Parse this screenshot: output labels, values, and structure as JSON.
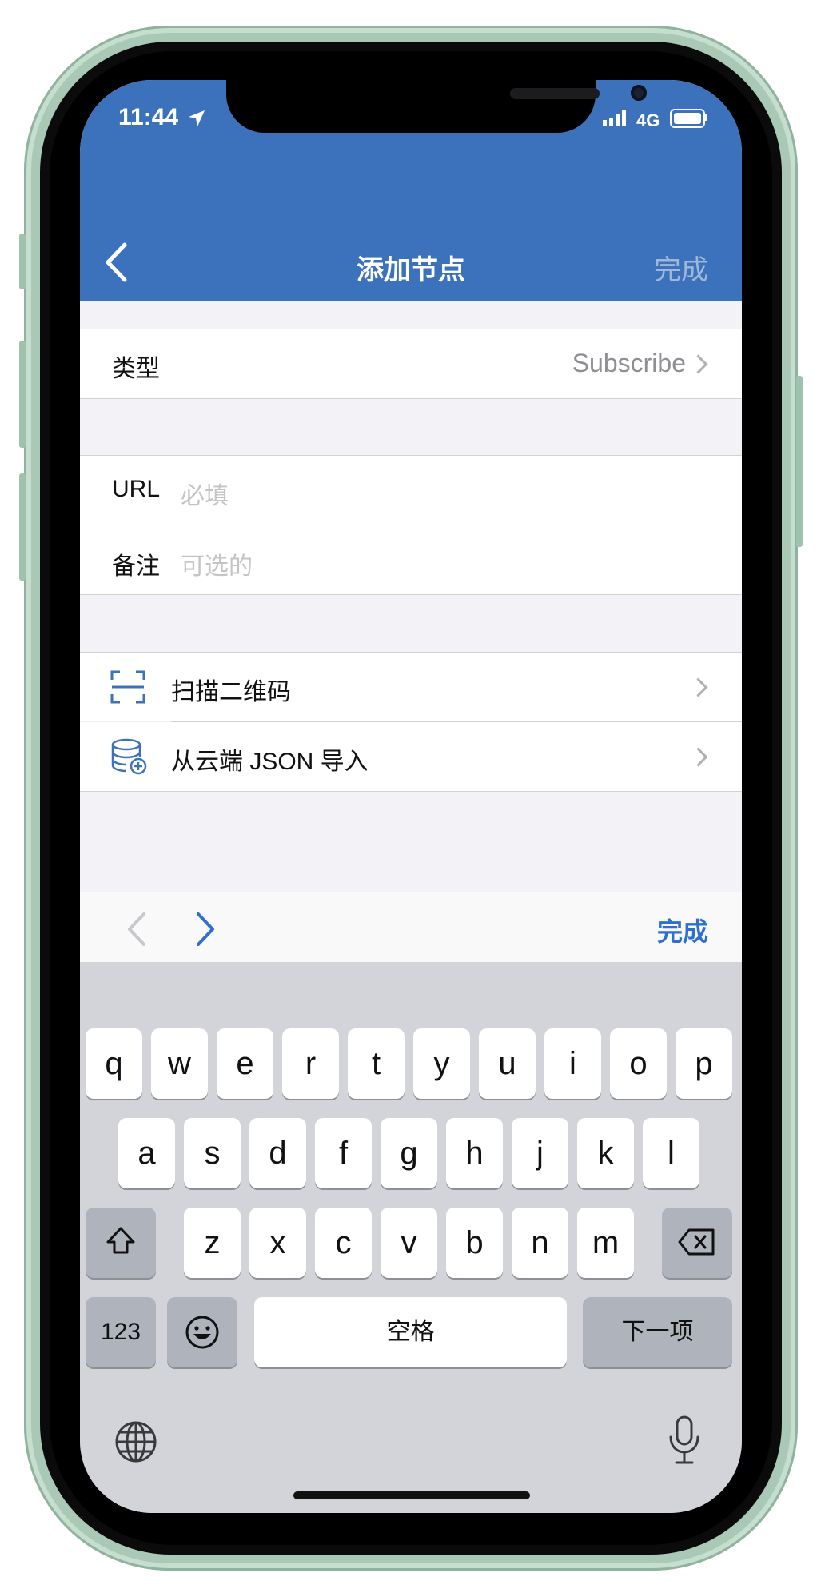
{
  "status_bar": {
    "time": "11:44",
    "network": "4G"
  },
  "nav": {
    "title": "添加节点",
    "done_label": "完成"
  },
  "form": {
    "type_row": {
      "label": "类型",
      "value": "Subscribe"
    },
    "url_row": {
      "label": "URL",
      "placeholder": "必填"
    },
    "note_row": {
      "label": "备注",
      "placeholder": "可选的"
    }
  },
  "actions": {
    "scan_qr": {
      "label": "扫描二维码"
    },
    "import_json": {
      "label": "从云端 JSON 导入"
    }
  },
  "input_toolbar": {
    "done_label": "完成"
  },
  "keyboard": {
    "row1": [
      "q",
      "w",
      "e",
      "r",
      "t",
      "y",
      "u",
      "i",
      "o",
      "p"
    ],
    "row2": [
      "a",
      "s",
      "d",
      "f",
      "g",
      "h",
      "j",
      "k",
      "l"
    ],
    "row3": [
      "z",
      "x",
      "c",
      "v",
      "b",
      "n",
      "m"
    ],
    "numbers_label": "123",
    "space_label": "空格",
    "next_label": "下一项"
  },
  "colors": {
    "nav": "#3b72bb",
    "accent": "#2f6fcf"
  }
}
